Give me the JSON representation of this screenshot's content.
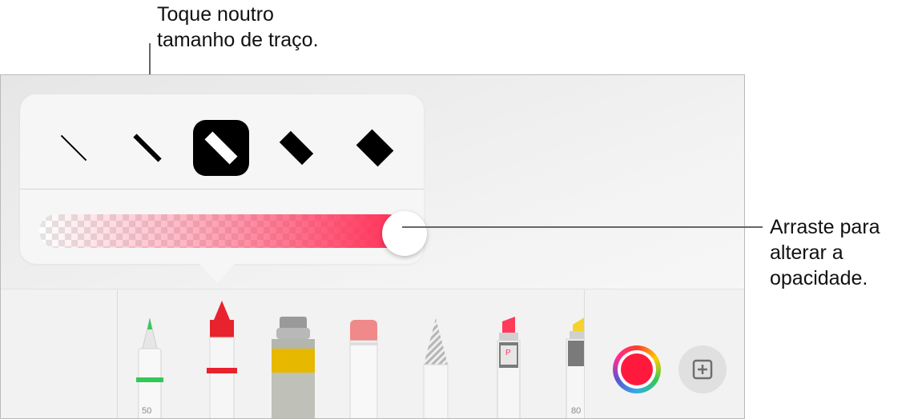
{
  "callouts": {
    "stroke_size": "Toque noutro\ntamanho de traço.",
    "opacity": "Arraste para\nalterar a\nopacidade."
  },
  "stroke_sizes": [
    {
      "name": "extra-thin",
      "selected": false
    },
    {
      "name": "thin",
      "selected": false
    },
    {
      "name": "medium",
      "selected": true
    },
    {
      "name": "thick",
      "selected": false
    },
    {
      "name": "extra-thick",
      "selected": false
    }
  ],
  "opacity": {
    "value": 1.0,
    "color": "#ff2d55"
  },
  "tools": [
    {
      "name": "pen",
      "label": "50",
      "accent": "#34c759"
    },
    {
      "name": "crayon",
      "accent": "#e8232e"
    },
    {
      "name": "watercolor",
      "accent": "#e6b800"
    },
    {
      "name": "eraser",
      "accent": "#f08a8a"
    },
    {
      "name": "pencil-hatched"
    },
    {
      "name": "marker",
      "letter": "P",
      "accent": "#ff3b5c"
    },
    {
      "name": "highlighter",
      "label": "80",
      "accent": "#f5d32a"
    }
  ],
  "current_color": "#ff1a3d",
  "icons": {
    "color_picker": "color-wheel-icon",
    "add": "plus-square-icon"
  }
}
